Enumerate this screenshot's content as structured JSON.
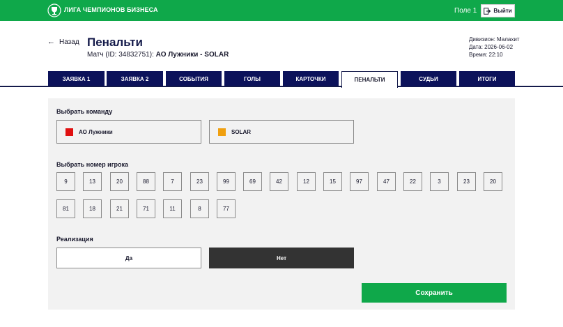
{
  "topbar": {
    "brand": "ЛИГА ЧЕМПИОНОВ БИЗНЕСА",
    "field": "Поле 1",
    "logout_label": "Выйти",
    "bg_color": "#0fa84a"
  },
  "header": {
    "back_label": "Назад",
    "title": "Пенальти",
    "match_prefix": "Матч (ID: 34832751): ",
    "match_name": "АО Лужники - SOLAR",
    "division": "Дивизион: Малахит",
    "date": "Дата: 2026-06-02",
    "time": "Время: 22:10"
  },
  "tabs": [
    {
      "label": "ЗАЯВКА 1",
      "active": false
    },
    {
      "label": "ЗАЯВКА 2",
      "active": false
    },
    {
      "label": "СОБЫТИЯ",
      "active": false
    },
    {
      "label": "ГОЛЫ",
      "active": false
    },
    {
      "label": "КАРТОЧКИ",
      "active": false
    },
    {
      "label": "ПЕНАЛЬТИ",
      "active": true
    },
    {
      "label": "СУДЬИ",
      "active": false
    },
    {
      "label": "ИТОГИ",
      "active": false
    }
  ],
  "team_section": {
    "label": "Выбрать команду",
    "teams": [
      {
        "name": "АО Лужники",
        "color": "#e01010"
      },
      {
        "name": "SOLAR",
        "color": "#f0a010"
      }
    ]
  },
  "player_section": {
    "label": "Выбрать номер игрока",
    "row1": [
      "9",
      "13",
      "20",
      "88",
      "7",
      "23",
      "99",
      "69",
      "42",
      "12",
      "15",
      "97",
      "47",
      "22",
      "3",
      "23",
      "20"
    ],
    "row2": [
      "81",
      "18",
      "21",
      "71",
      "11",
      "8",
      "77"
    ]
  },
  "realization": {
    "label": "Реализация",
    "yes_label": "Да",
    "no_label": "Нет",
    "selected": "Нет"
  },
  "save_label": "Сохранить"
}
